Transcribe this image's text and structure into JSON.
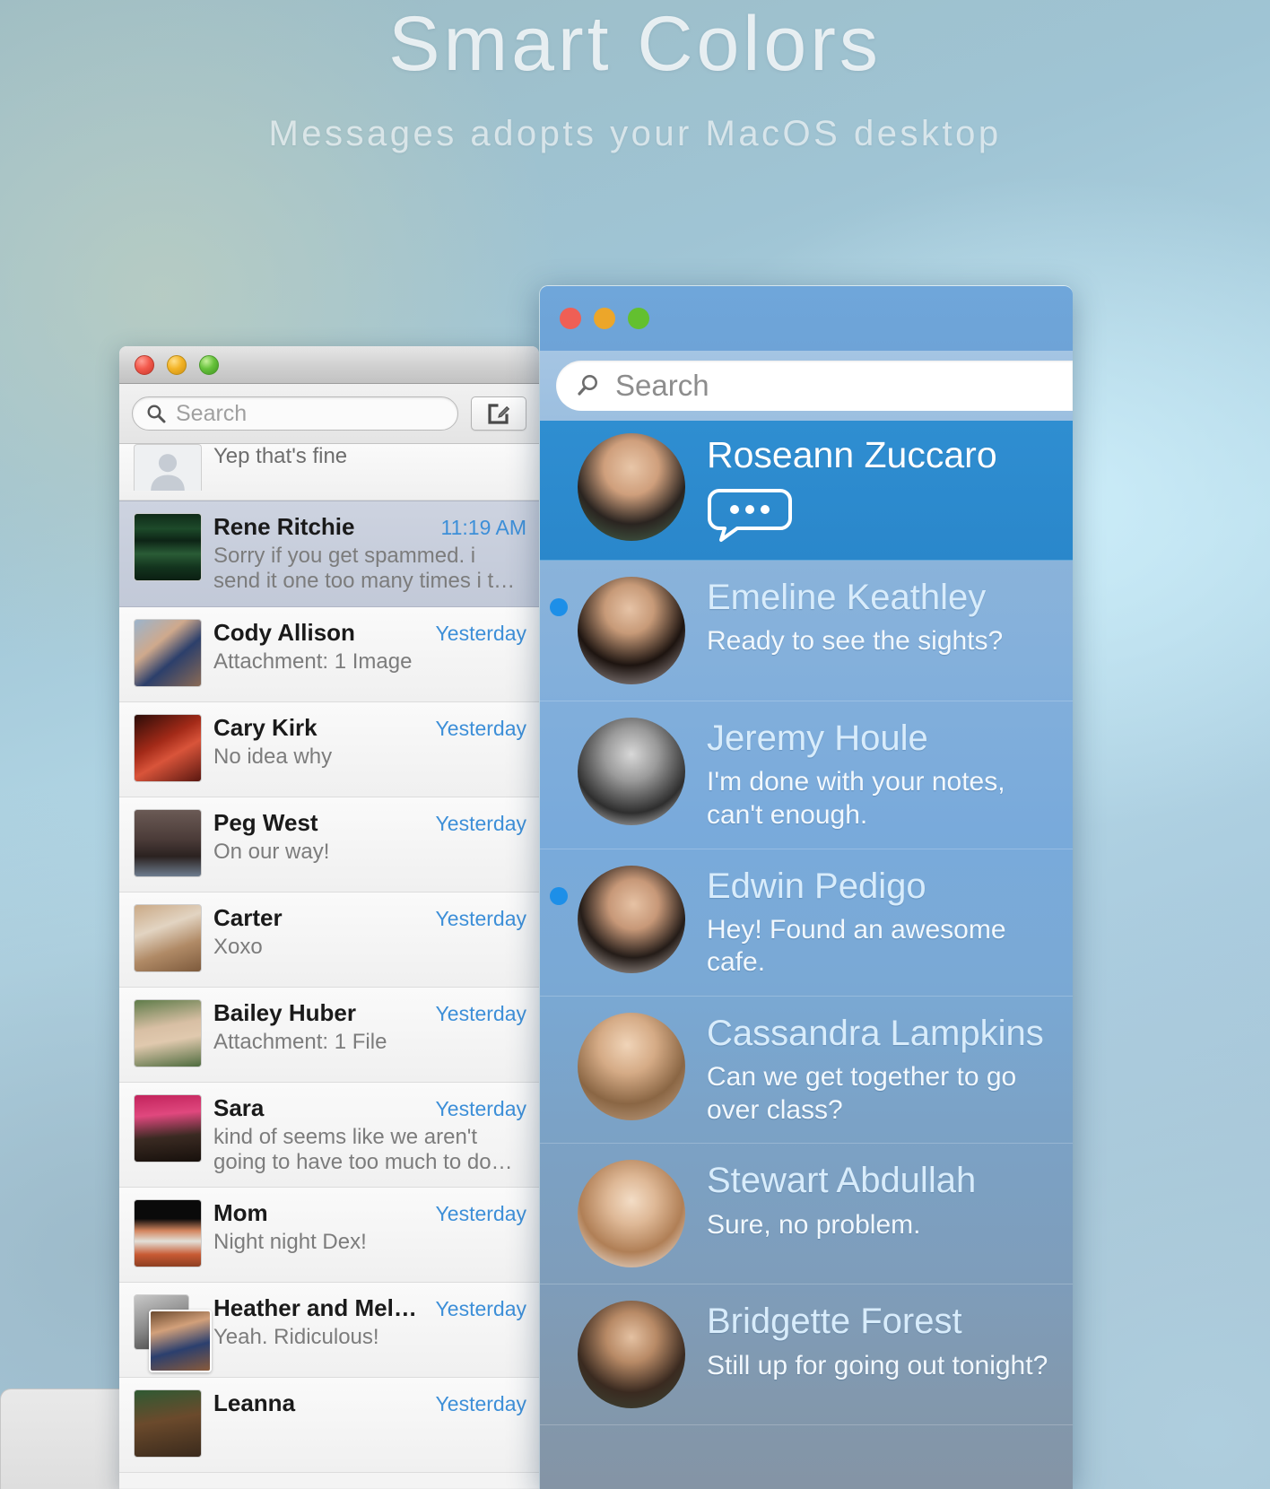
{
  "hero": {
    "title": "Smart Colors",
    "subtitle": "Messages adopts your MacOS desktop"
  },
  "colors": {
    "accent_blue": "#2f8ed1",
    "unread_dot": "#1d8fe8",
    "timestamp_blue": "#3d8fd8",
    "traffic_red": "#ef5f55",
    "traffic_yellow": "#eca62a",
    "traffic_green": "#63c02f"
  },
  "left_window": {
    "window_controls": [
      "close",
      "minimize",
      "zoom"
    ],
    "search": {
      "placeholder": "Search",
      "value": "",
      "icon": "search-icon"
    },
    "compose_button": {
      "icon": "compose-icon",
      "label": ""
    },
    "conversations": [
      {
        "name": "",
        "preview": "Yep that's fine",
        "time": "",
        "selected": false,
        "partial": true,
        "avatar": "person-placeholder"
      },
      {
        "name": "Rene Ritchie",
        "preview": "Sorry if you get spammed. i send it one too many times i t…",
        "time": "11:19 AM",
        "selected": true,
        "avatar": "photo"
      },
      {
        "name": "Cody Allison",
        "preview": "Attachment: 1 Image",
        "time": "Yesterday",
        "selected": false,
        "avatar": "photo"
      },
      {
        "name": "Cary Kirk",
        "preview": "No idea why",
        "time": "Yesterday",
        "selected": false,
        "avatar": "photo"
      },
      {
        "name": "Peg West",
        "preview": "On our way!",
        "time": "Yesterday",
        "selected": false,
        "avatar": "photo"
      },
      {
        "name": "Carter",
        "preview": "Xoxo",
        "time": "Yesterday",
        "selected": false,
        "avatar": "photo"
      },
      {
        "name": "Bailey Huber",
        "preview": "Attachment: 1 File",
        "time": "Yesterday",
        "selected": false,
        "avatar": "photo"
      },
      {
        "name": "Sara",
        "preview": "kind of seems like we aren't going to have too much to do…",
        "time": "Yesterday",
        "selected": false,
        "avatar": "photo"
      },
      {
        "name": "Mom",
        "preview": "Night night Dex!",
        "time": "Yesterday",
        "selected": false,
        "avatar": "photo"
      },
      {
        "name": "Heather and Mel…",
        "preview": "Yeah. Ridiculous!",
        "time": "Yesterday",
        "selected": false,
        "avatar": "photo-stack"
      },
      {
        "name": "Leanna",
        "preview": "",
        "time": "Yesterday",
        "selected": false,
        "avatar": "photo"
      }
    ]
  },
  "right_window": {
    "window_controls": [
      "close",
      "minimize",
      "zoom"
    ],
    "search": {
      "placeholder": "Search",
      "value": "",
      "icon": "search-icon"
    },
    "conversations": [
      {
        "name": "Roseann Zuccaro",
        "preview": "",
        "selected": true,
        "unread": false,
        "typing_indicator": "typing-bubble-icon"
      },
      {
        "name": "Emeline Keathley",
        "preview": "Ready to see the sights?",
        "selected": false,
        "unread": true
      },
      {
        "name": "Jeremy Houle",
        "preview": "I'm done with your notes, can't enough.",
        "selected": false,
        "unread": false
      },
      {
        "name": "Edwin Pedigo",
        "preview": "Hey! Found an awesome cafe.",
        "selected": false,
        "unread": true
      },
      {
        "name": "Cassandra Lampkins",
        "preview": "Can we get together to go over class?",
        "selected": false,
        "unread": false
      },
      {
        "name": "Stewart Abdullah",
        "preview": "Sure, no problem.",
        "selected": false,
        "unread": false
      },
      {
        "name": "Bridgette Forest",
        "preview": "Still up for going out tonight?",
        "selected": false,
        "unread": false
      }
    ]
  }
}
